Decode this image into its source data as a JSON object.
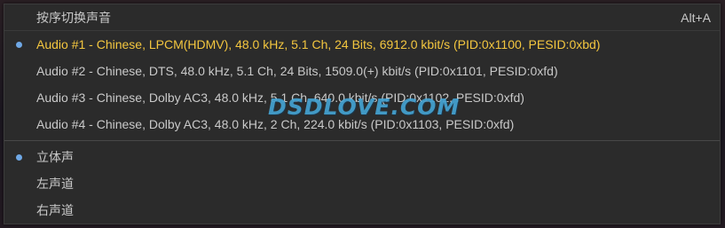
{
  "menu": {
    "header": {
      "label": "按序切换声音",
      "shortcut": "Alt+A"
    },
    "audio_tracks": [
      {
        "label": "Audio #1 - Chinese, LPCM(HDMV), 48.0 kHz, 5.1 Ch, 24 Bits, 6912.0 kbit/s (PID:0x1100, PESID:0xbd)",
        "selected": true
      },
      {
        "label": "Audio #2 - Chinese, DTS, 48.0 kHz, 5.1 Ch, 24 Bits, 1509.0(+) kbit/s (PID:0x1101, PESID:0xfd)",
        "selected": false
      },
      {
        "label": "Audio #3 - Chinese, Dolby AC3, 48.0 kHz, 5.1 Ch, 640.0 kbit/s (PID:0x1102, PESID:0xfd)",
        "selected": false
      },
      {
        "label": "Audio #4 - Chinese, Dolby AC3, 48.0 kHz, 2 Ch, 224.0 kbit/s (PID:0x1103, PESID:0xfd)",
        "selected": false
      }
    ],
    "channels": [
      {
        "label": "立体声",
        "selected": true
      },
      {
        "label": "左声道",
        "selected": false
      },
      {
        "label": "右声道",
        "selected": false
      }
    ]
  },
  "watermark": "DSDLOVE.COM",
  "colors": {
    "menu_bg": "#2b2b2b",
    "text": "#c9c9c9",
    "active_text": "#f3c63f",
    "radio": "#6fa8e6",
    "watermark": "#48aadc"
  }
}
